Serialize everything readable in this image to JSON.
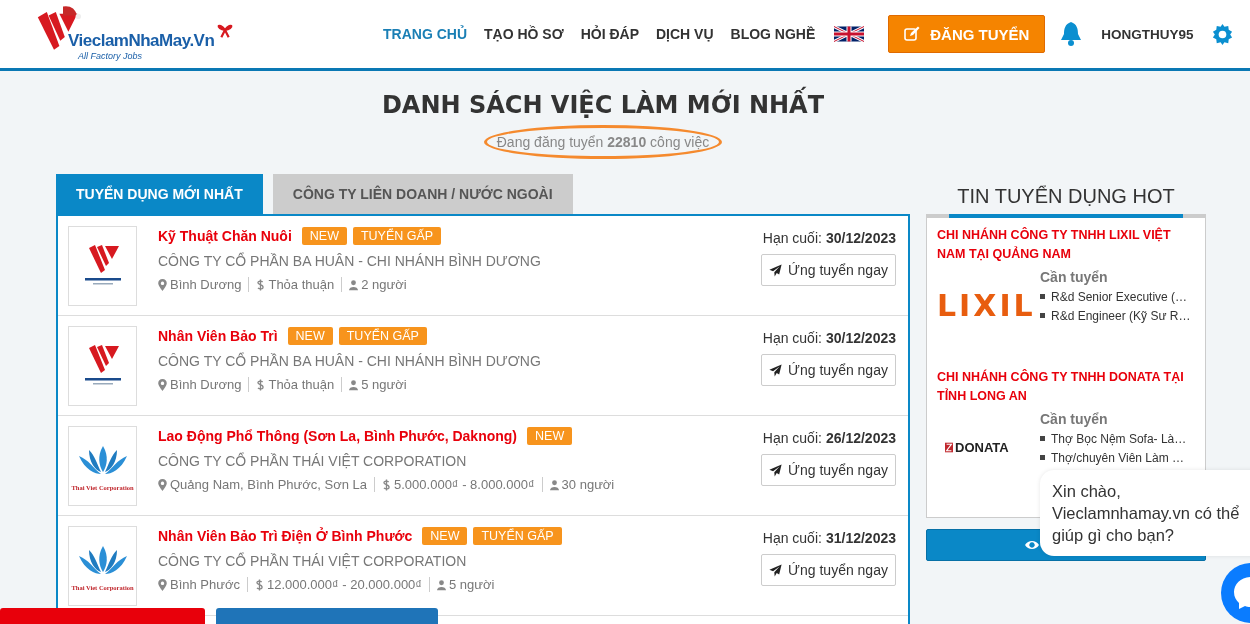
{
  "logo": {
    "name": "VieclamNhaMay.Vn",
    "tagline": "All Factory Jobs"
  },
  "nav": [
    {
      "label": "TRANG CHỦ",
      "selected": true
    },
    {
      "label": "TẠO HỒ SƠ",
      "selected": false
    },
    {
      "label": "HỎI ĐÁP",
      "selected": false
    },
    {
      "label": "DỊCH VỤ",
      "selected": false
    },
    {
      "label": "BLOG NGHỀ",
      "selected": false
    }
  ],
  "post_button": "ĐĂNG TUYỂN",
  "username": "HONGTHUY95",
  "heading": "DANH SÁCH VIỆC LÀM MỚI NHẤT",
  "count_text": "Đang đăng tuyển **22810** công việc",
  "tabs": [
    {
      "label": "TUYỂN DỤNG MỚI NHẤT",
      "selected": true
    },
    {
      "label": "CÔNG TY LIÊN DOANH / NƯỚC NGOÀI",
      "selected": false
    }
  ],
  "jobs": [
    {
      "kind": "vieclam",
      "title": "Kỹ Thuật Chăn Nuôi",
      "badges": [
        "NEW",
        "TUYỂN GẤP"
      ],
      "company": "CÔNG TY CỔ PHẦN BA HUÂN - CHI NHÁNH BÌNH DƯƠNG",
      "location": "Bình Dương",
      "salary": "Thỏa thuận",
      "headcount": "2 người",
      "deadline_label": "Hạn cuối:",
      "deadline": "30/12/2023",
      "apply": "Ứng tuyển ngay"
    },
    {
      "kind": "vieclam",
      "title": "Nhân Viên Bảo Trì",
      "badges": [
        "NEW",
        "TUYỂN GẤP"
      ],
      "company": "CÔNG TY CỔ PHẦN BA HUÂN - CHI NHÁNH BÌNH DƯƠNG",
      "location": "Bình Dương",
      "salary": "Thỏa thuận",
      "headcount": "5 người",
      "deadline_label": "Hạn cuối:",
      "deadline": "30/12/2023",
      "apply": "Ứng tuyển ngay"
    },
    {
      "kind": "thaiviet",
      "logo_text": "Thai Viet Corporation",
      "title": "Lao Động Phổ Thông (Sơn La, Bình Phước, Daknong)",
      "badges": [
        "NEW"
      ],
      "company": "CÔNG TY CỔ PHẦN THÁI VIỆT CORPORATION",
      "location": "Quảng Nam, Bình Phước, Sơn La",
      "salary": "5.000.000₫ - 8.000.000₫",
      "headcount": "30 người",
      "deadline_label": "Hạn cuối:",
      "deadline": "26/12/2023",
      "apply": "Ứng tuyển ngay"
    },
    {
      "kind": "thaiviet",
      "logo_text": "Thai Viet Corporation",
      "title": "Nhân Viên Bảo Trì Điện Ở Bình Phước",
      "badges": [
        "NEW",
        "TUYỂN GẤP"
      ],
      "company": "CÔNG TY CỔ PHẦN THÁI VIỆT CORPORATION",
      "location": "Bình Phước",
      "salary": "12.000.000₫ - 20.000.000₫",
      "headcount": "5 người",
      "deadline_label": "Hạn cuối:",
      "deadline": "31/12/2023",
      "apply": "Ứng tuyển ngay"
    }
  ],
  "hot": {
    "heading": "TIN TUYỂN DỤNG HOT",
    "items": [
      {
        "company": "CHI NHÁNH CÔNG TY TNHH LIXIL VIỆT NAM TẠI QUẢNG NAM",
        "kind": "lixil",
        "logo_text": "LIXIL",
        "label": "Cần tuyển",
        "positions": [
          "R&d Senior Executive (…",
          "R&d Engineer (Kỹ Sư R…"
        ]
      },
      {
        "company": "CHI NHÁNH CÔNG TY TNHH DONATA TẠI TỈNH LONG AN",
        "kind": "donata",
        "logo_text": "DONATA",
        "label": "Cần tuyển",
        "positions": [
          "Thợ Bọc Nệm Sofa- Là…",
          "Thợ/chuyên Viên Làm …"
        ]
      }
    ]
  },
  "chat": {
    "message": "Xin chào, Vieclamnhamay.vn có thể giúp gì cho bạn?"
  }
}
